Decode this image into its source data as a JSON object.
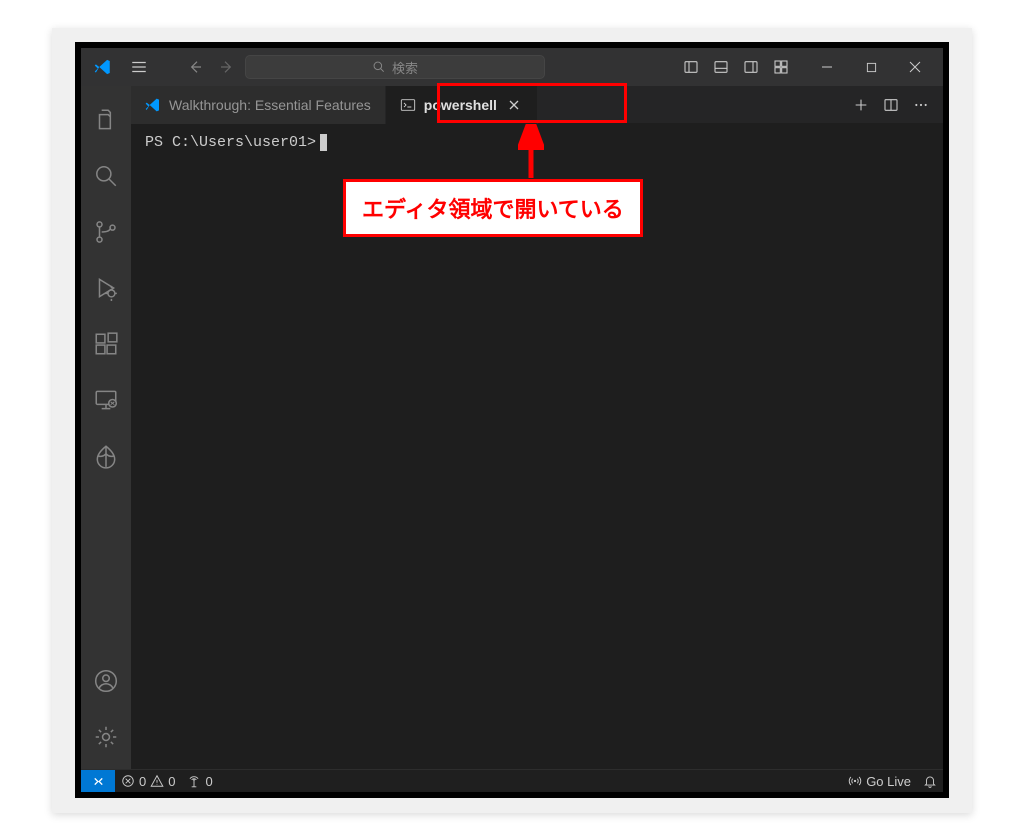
{
  "search_placeholder": "検索",
  "tabs": {
    "walkthrough": {
      "label": "Walkthrough: Essential Features"
    },
    "powershell": {
      "label": "powershell"
    }
  },
  "terminal": {
    "prompt": "PS C:\\Users\\user01>"
  },
  "annotation": {
    "text": "エディタ領域で開いている"
  },
  "status": {
    "errors": "0",
    "warnings": "0",
    "port": "0",
    "golive": "Go Live"
  }
}
